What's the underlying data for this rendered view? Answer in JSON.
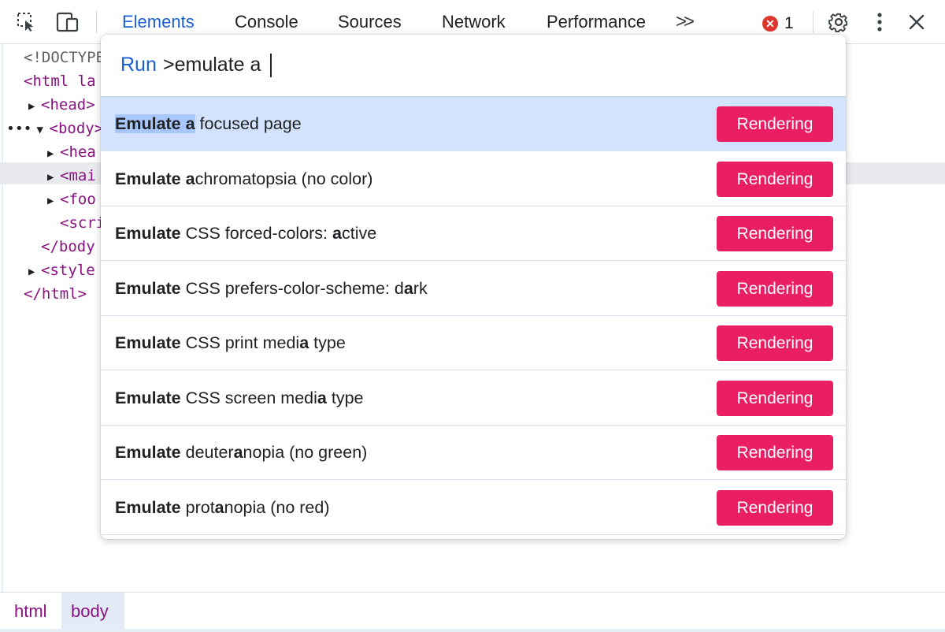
{
  "toolbar": {
    "tabs": [
      "Elements",
      "Console",
      "Sources",
      "Network",
      "Performance"
    ],
    "more_tabs": ">>",
    "error_count": "1",
    "error_glyph": "✕",
    "icons": [
      "inspect-element-icon",
      "device-toolbar-icon",
      "gear-icon",
      "more-vert-icon",
      "close-icon"
    ],
    "accent_color": "#1a5fd3",
    "error_color": "#dc362e"
  },
  "dom": {
    "lines": [
      "<!DOCTYPE",
      "<html la",
      "<head>",
      "<body>",
      "<hea",
      "<mai",
      "<foo",
      "<scri",
      "</body",
      "<style",
      "</html>"
    ],
    "selected_line": "<body>"
  },
  "palette": {
    "prefix": "Run",
    "query": ">emulate a",
    "items": [
      {
        "parts": [
          {
            "t": "Emulate a",
            "b": true,
            "hl": true
          },
          {
            "t": " focused page",
            "b": false
          }
        ],
        "badge": "Rendering",
        "selected": true
      },
      {
        "parts": [
          {
            "t": "Emulate",
            "b": true
          },
          {
            "t": " ",
            "b": false
          },
          {
            "t": "a",
            "b": true
          },
          {
            "t": "chromatopsia (no color)",
            "b": false
          }
        ],
        "badge": "Rendering"
      },
      {
        "parts": [
          {
            "t": "Emulate",
            "b": true
          },
          {
            "t": " CSS forced-colors: ",
            "b": false
          },
          {
            "t": "a",
            "b": true
          },
          {
            "t": "ctive",
            "b": false
          }
        ],
        "badge": "Rendering"
      },
      {
        "parts": [
          {
            "t": "Emulate",
            "b": true
          },
          {
            "t": " CSS prefers-color-scheme: d",
            "b": false
          },
          {
            "t": "a",
            "b": true
          },
          {
            "t": "rk",
            "b": false
          }
        ],
        "badge": "Rendering"
      },
      {
        "parts": [
          {
            "t": "Emulate",
            "b": true
          },
          {
            "t": " CSS print medi",
            "b": false
          },
          {
            "t": "a",
            "b": true
          },
          {
            "t": " type",
            "b": false
          }
        ],
        "badge": "Rendering"
      },
      {
        "parts": [
          {
            "t": "Emulate",
            "b": true
          },
          {
            "t": " CSS screen medi",
            "b": false
          },
          {
            "t": "a",
            "b": true
          },
          {
            "t": " type",
            "b": false
          }
        ],
        "badge": "Rendering"
      },
      {
        "parts": [
          {
            "t": "Emulate",
            "b": true
          },
          {
            "t": " deuter",
            "b": false
          },
          {
            "t": "a",
            "b": true
          },
          {
            "t": "nopia (no green)",
            "b": false
          }
        ],
        "badge": "Rendering"
      },
      {
        "parts": [
          {
            "t": "Emulate",
            "b": true
          },
          {
            "t": " prot",
            "b": false
          },
          {
            "t": "a",
            "b": true
          },
          {
            "t": "nopia (no red)",
            "b": false
          }
        ],
        "badge": "Rendering"
      }
    ],
    "badge_color": "#e91e63",
    "selected_color": "#d3e3fd"
  },
  "breadcrumbs": [
    "html",
    "body"
  ]
}
